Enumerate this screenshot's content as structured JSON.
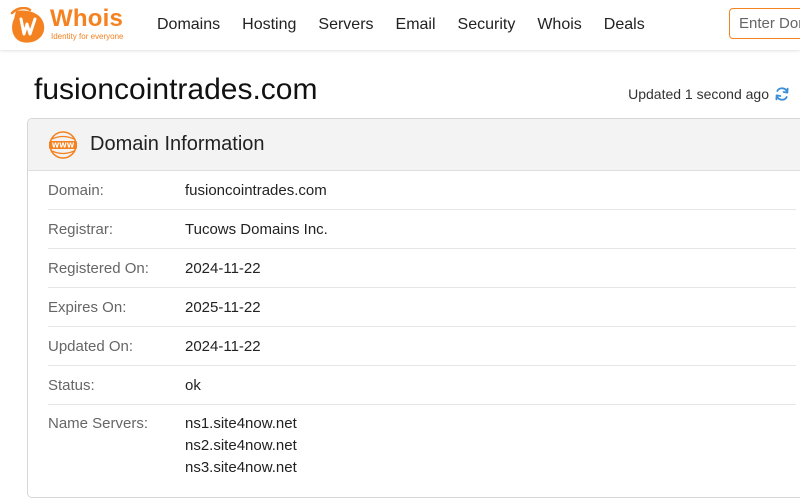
{
  "brand": {
    "name": "Whois",
    "tagline": "Identity for everyone",
    "accent_color": "#f58220"
  },
  "nav": {
    "items": [
      {
        "label": "Domains"
      },
      {
        "label": "Hosting"
      },
      {
        "label": "Servers"
      },
      {
        "label": "Email"
      },
      {
        "label": "Security"
      },
      {
        "label": "Whois"
      },
      {
        "label": "Deals"
      }
    ]
  },
  "search": {
    "placeholder": "Enter Domain or IP"
  },
  "page": {
    "title": "fusioncointrades.com",
    "updated_text": "Updated 1 second ago"
  },
  "domain_info": {
    "heading": "Domain Information",
    "rows": [
      {
        "label": "Domain:",
        "value": "fusioncointrades.com"
      },
      {
        "label": "Registrar:",
        "value": "Tucows Domains Inc."
      },
      {
        "label": "Registered On:",
        "value": "2024-11-22"
      },
      {
        "label": "Expires On:",
        "value": "2025-11-22"
      },
      {
        "label": "Updated On:",
        "value": "2024-11-22"
      },
      {
        "label": "Status:",
        "value": "ok"
      }
    ],
    "name_servers": {
      "label": "Name Servers:",
      "values": [
        "ns1.site4now.net",
        "ns2.site4now.net",
        "ns3.site4now.net"
      ]
    }
  },
  "icons": {
    "logo": "whois-logo-icon",
    "refresh": "refresh-icon",
    "section": "www-globe-icon"
  }
}
